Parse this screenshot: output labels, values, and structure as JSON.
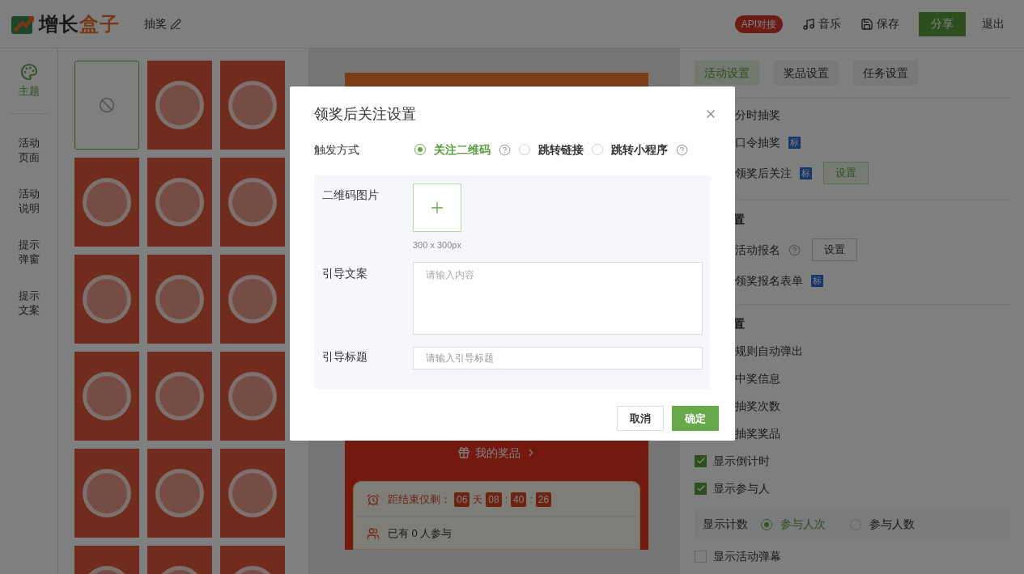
{
  "header": {
    "logo_text": [
      "增长",
      "盒子"
    ],
    "title": "抽奖",
    "api_badge": "API对接",
    "actions": [
      {
        "kind": "music",
        "label": "音乐"
      },
      {
        "kind": "save",
        "label": "保存"
      }
    ],
    "share_button": "分享",
    "exit_link": "退出"
  },
  "nav": [
    {
      "kind": "theme",
      "label": "主题",
      "selected": true
    },
    {
      "kind": "text",
      "label": "活动页面",
      "selected": false
    },
    {
      "kind": "text",
      "label": "活动说明",
      "selected": false
    },
    {
      "kind": "text",
      "label": "提示弹窗",
      "selected": false
    },
    {
      "kind": "text",
      "label": "提示文案",
      "selected": false
    }
  ],
  "templates": [
    {
      "kind": "empty",
      "selected": true
    },
    {
      "kind": "poster",
      "selected": false
    },
    {
      "kind": "poster",
      "selected": false
    },
    {
      "kind": "poster",
      "selected": false
    },
    {
      "kind": "poster",
      "selected": false
    },
    {
      "kind": "poster",
      "selected": false
    },
    {
      "kind": "poster",
      "selected": false
    },
    {
      "kind": "poster",
      "selected": false
    },
    {
      "kind": "poster",
      "selected": false
    },
    {
      "kind": "poster",
      "selected": false
    },
    {
      "kind": "poster",
      "selected": false
    },
    {
      "kind": "poster",
      "selected": false
    },
    {
      "kind": "poster",
      "selected": false
    },
    {
      "kind": "poster",
      "selected": false
    },
    {
      "kind": "poster",
      "selected": false
    },
    {
      "kind": "poster",
      "selected": false
    },
    {
      "kind": "poster",
      "selected": false
    },
    {
      "kind": "poster",
      "selected": false
    }
  ],
  "preview": {
    "prize_link": "我的奖品",
    "countdown": {
      "label": "距结束仅剩：",
      "parts": [
        {
          "kind": "num",
          "text": "06"
        },
        {
          "kind": "sep",
          "text": "天"
        },
        {
          "kind": "num",
          "text": "08"
        },
        {
          "kind": "sep",
          "text": ":"
        },
        {
          "kind": "num",
          "text": "40"
        },
        {
          "kind": "sep",
          "text": ":"
        },
        {
          "kind": "num",
          "text": "26"
        }
      ]
    },
    "participants": "已有 0 人参与"
  },
  "settings": {
    "tabs": [
      {
        "label": "活动设置",
        "selected": true
      },
      {
        "label": "奖品设置",
        "selected": false
      },
      {
        "label": "任务设置",
        "selected": false
      }
    ],
    "items": [
      {
        "kind": "text",
        "label": "分时抽奖"
      },
      {
        "kind": "text",
        "label": "口令抽奖",
        "badge": "标"
      },
      {
        "kind": "text",
        "label": "领奖后关注",
        "badge": "标",
        "button": {
          "label": "设置",
          "highlighted": true
        }
      },
      {
        "kind": "heading",
        "label": "置"
      },
      {
        "kind": "text",
        "label": "活动报名",
        "help": true,
        "button": {
          "label": "设置",
          "highlighted": false
        }
      },
      {
        "kind": "text",
        "label": "领奖报名表单",
        "badge": "标"
      },
      {
        "kind": "heading",
        "label": "置"
      },
      {
        "kind": "text",
        "label": "规则自动弹出"
      },
      {
        "kind": "text",
        "label": "中奖信息"
      },
      {
        "kind": "text",
        "label": "抽奖次数"
      },
      {
        "kind": "text",
        "label": "抽奖奖品"
      },
      {
        "kind": "checkbox",
        "label": "显示倒计时",
        "checked": true
      },
      {
        "kind": "checkbox",
        "label": "显示参与人",
        "checked": true
      },
      {
        "kind": "radio_group",
        "label": "显示计数",
        "options": [
          {
            "label": "参与人次",
            "selected": true
          },
          {
            "label": "参与人数",
            "selected": false
          }
        ]
      },
      {
        "kind": "checkbox",
        "label": "显示活动弹幕",
        "checked": false
      }
    ]
  },
  "dialog": {
    "title": "领奖后关注设置",
    "trigger_label": "触发方式",
    "trigger_options": [
      {
        "label": "关注二维码",
        "selected": true,
        "help": true
      },
      {
        "label": "跳转链接",
        "selected": false,
        "help": false
      },
      {
        "label": "跳转小程序",
        "selected": false,
        "help": true
      }
    ],
    "qr_label": "二维码图片",
    "qr_hint": "300 x 300px",
    "copy_label": "引导文案",
    "copy_placeholder": "请输入内容",
    "title_label": "引导标题",
    "title_placeholder": "请输入引导标题",
    "cancel": "取消",
    "confirm": "确定"
  }
}
